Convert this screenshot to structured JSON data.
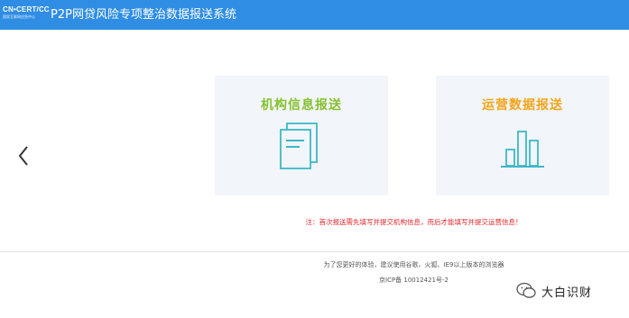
{
  "header": {
    "logo_top": "CN•CERT/CC",
    "logo_bottom": "国家互联网应急中心",
    "title": "P2P网贷风险专项整治数据报送系统"
  },
  "nav": {
    "prev_icon": "chevron-left-icon"
  },
  "cards": [
    {
      "title": "机构信息报送",
      "icon": "documents-icon",
      "color": "#86c12f"
    },
    {
      "title": "运营数据报送",
      "icon": "bar-chart-icon",
      "color": "#f3a51a"
    }
  ],
  "notice": "注：首次报送需先填写并提交机构信息，而后才能填写并提交运营信息！",
  "footer": {
    "browser_note": "为了您更好的体验，建议使用谷歌、火狐、IE9以上版本的浏览器",
    "icp": "京ICP备 10012421号-2"
  },
  "watermark": {
    "text": "大白识财",
    "icon": "wechat-icon"
  },
  "colors": {
    "header": "#2f8de4",
    "notice": "#e0262b",
    "icon_stroke": "#3cb8c8"
  }
}
